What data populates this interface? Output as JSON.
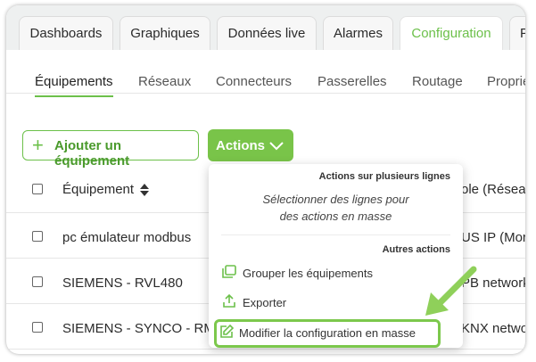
{
  "tabs": [
    "Dashboards",
    "Graphiques",
    "Données live",
    "Alarmes",
    "Configuration",
    "P"
  ],
  "subtabs": [
    "Équipements",
    "Réseaux",
    "Connecteurs",
    "Passerelles",
    "Routage",
    "Proprié"
  ],
  "toolbar": {
    "add_label": "Ajouter un équipement",
    "actions_label": "Actions"
  },
  "table": {
    "header_name": "Équipement",
    "header_protocol": "ole (Résea",
    "rows": [
      {
        "name": "pc émulateur modbus",
        "protocol": "US IP (Mor"
      },
      {
        "name": "SIEMENS - RVL480",
        "protocol": "PB network"
      },
      {
        "name": "SIEMENS - SYNCO - RM",
        "protocol": "KNX netwo"
      }
    ]
  },
  "dropdown": {
    "multi_header": "Actions sur plusieurs lignes",
    "multi_desc_1": "Sélectionner des lignes pour",
    "multi_desc_2": "des actions en masse",
    "other_header": "Autres actions",
    "items": [
      {
        "label": "Grouper les équipements",
        "icon": "group-icon"
      },
      {
        "label": "Exporter",
        "icon": "export-icon"
      },
      {
        "label": "Modifier la configuration en masse",
        "icon": "edit-icon"
      }
    ]
  },
  "colors": {
    "accent": "#79c449",
    "accent_dark": "#4a9a2c"
  }
}
